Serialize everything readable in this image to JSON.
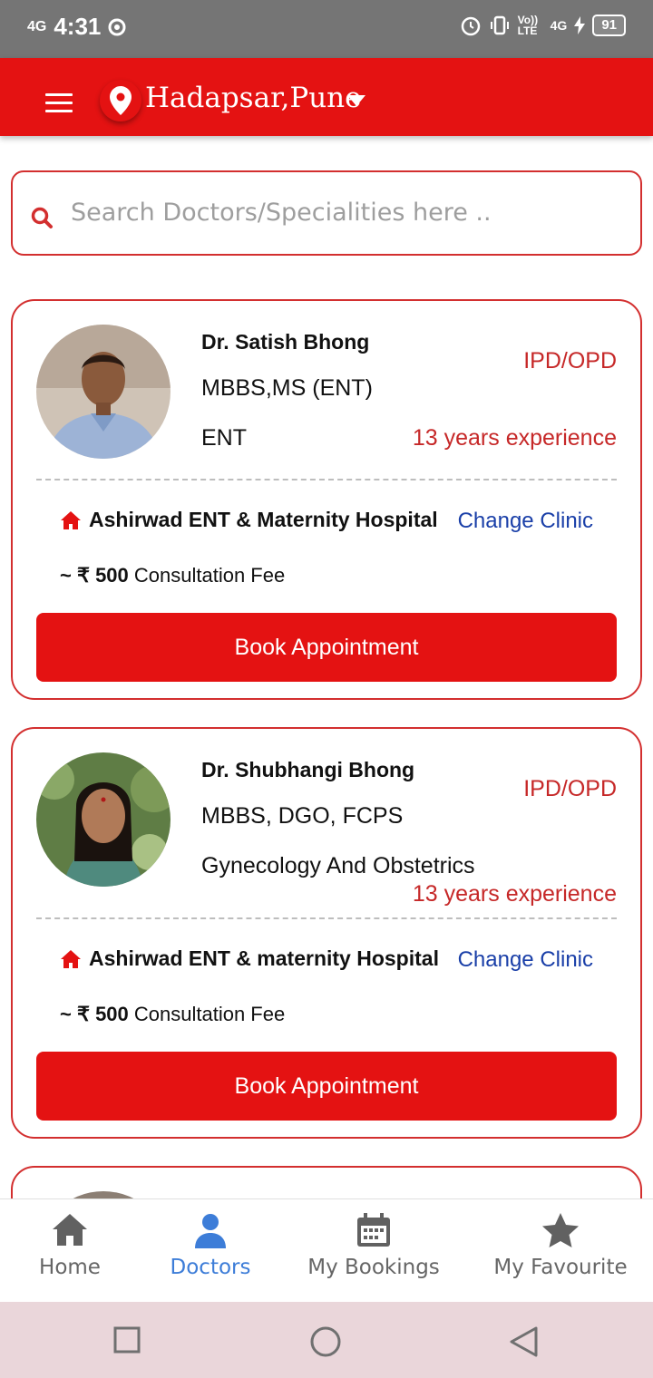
{
  "status_bar": {
    "network": "4G",
    "time": "4:31",
    "volte": "Vo)) LTE",
    "net_right": "4G",
    "battery": "91"
  },
  "header": {
    "location": "Hadapsar,Pune"
  },
  "search": {
    "placeholder": "Search Doctors/Specialities here .."
  },
  "doctors": [
    {
      "name": "Dr. Satish Bhong",
      "degree": "MBBS,MS (ENT)",
      "specialty": "ENT",
      "type": "IPD/OPD",
      "experience": "13 years experience",
      "clinic": "Ashirwad ENT & Maternity Hospital",
      "change_clinic": "Change Clinic",
      "fee_prefix": "~ ₹ 500",
      "fee_label": " Consultation Fee",
      "book_label": "Book Appointment"
    },
    {
      "name": "Dr. Shubhangi Bhong",
      "degree": "MBBS, DGO, FCPS",
      "specialty": "Gynecology And Obstetrics",
      "type": "IPD/OPD",
      "experience": "13 years experience",
      "clinic": "Ashirwad ENT & maternity Hospital",
      "change_clinic": "Change Clinic",
      "fee_prefix": "~ ₹ 500",
      "fee_label": " Consultation Fee",
      "book_label": "Book Appointment"
    }
  ],
  "bottom_nav": [
    {
      "label": "Home",
      "icon": "home-icon",
      "active": false
    },
    {
      "label": "Doctors",
      "icon": "doctor-icon",
      "active": true
    },
    {
      "label": "My Bookings",
      "icon": "calendar-icon",
      "active": false
    },
    {
      "label": "My Favourite",
      "icon": "star-icon",
      "active": false
    }
  ],
  "colors": {
    "primary": "#e41212",
    "accent_text": "#c62828",
    "link": "#1a3fa8",
    "nav_active": "#3d7dd8"
  }
}
